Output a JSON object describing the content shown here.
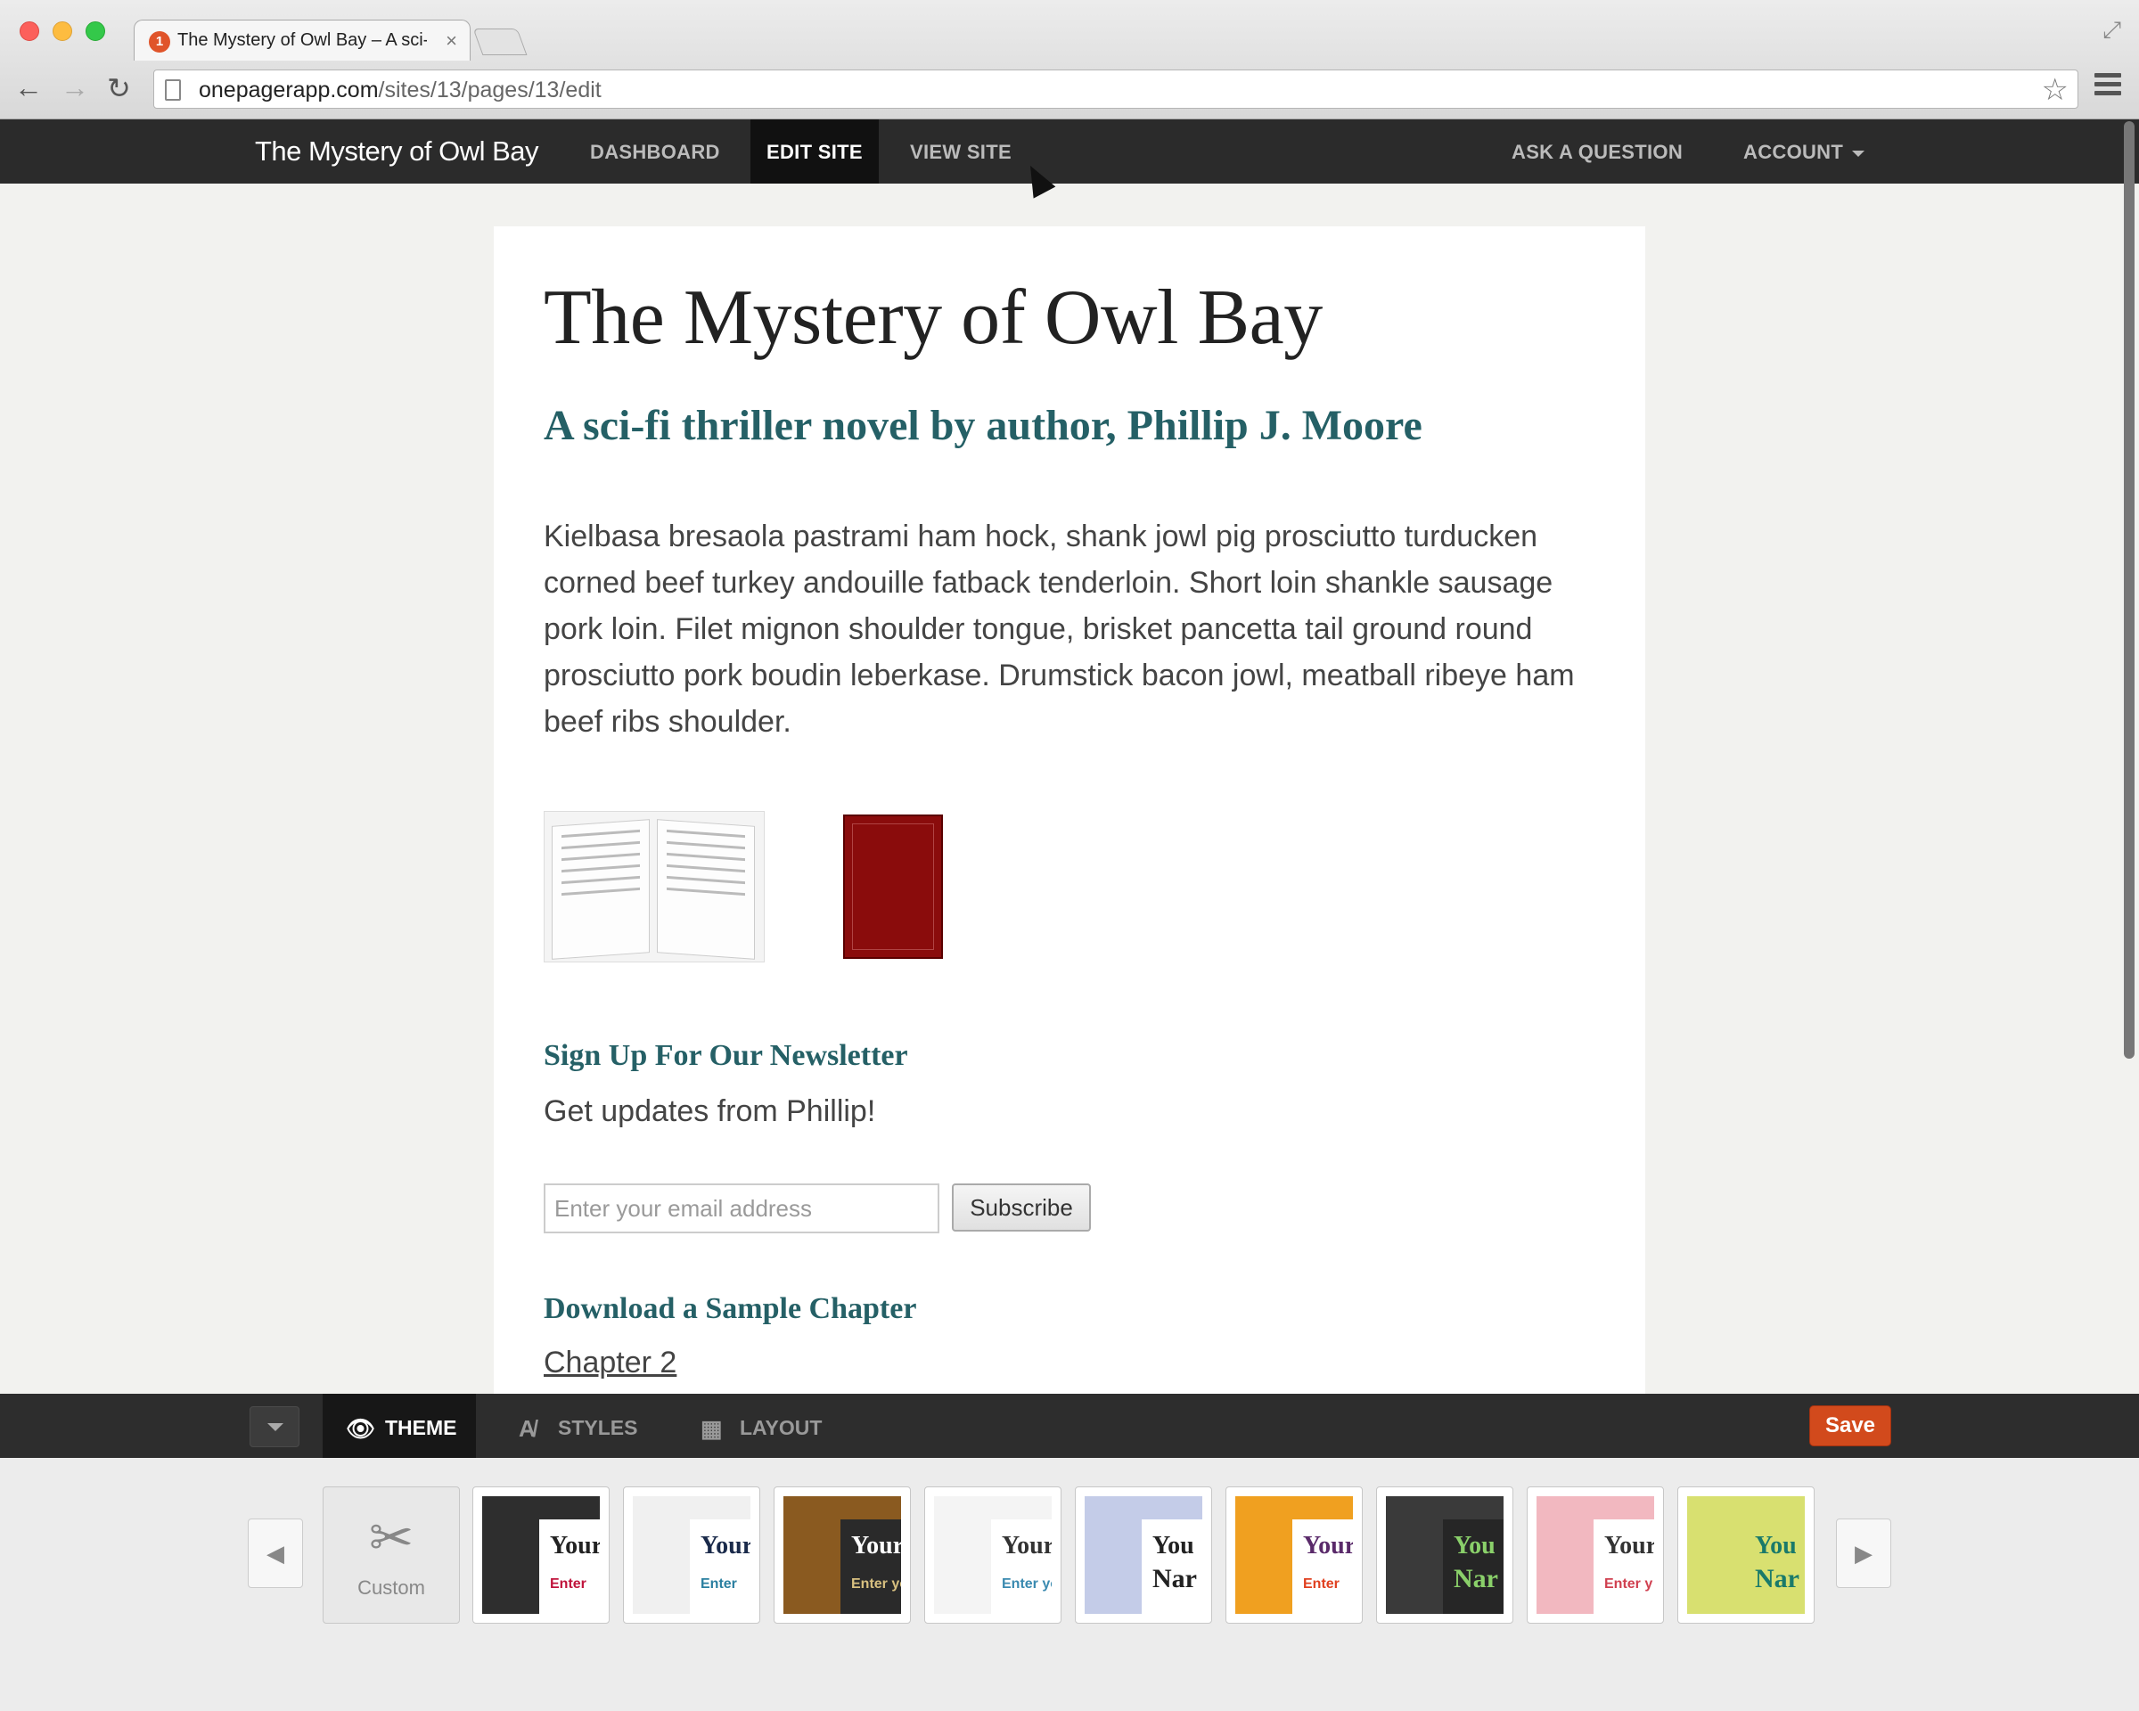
{
  "browser": {
    "tab_title": "The Mystery of Owl Bay – A sci-fi thriller",
    "tab_favicon": "1",
    "url_host": "onepagerapp.com",
    "url_path": "/sites/13/pages/13/edit"
  },
  "appbar": {
    "brand": "The Mystery of Owl Bay",
    "nav": [
      "DASHBOARD",
      "EDIT SITE",
      "VIEW SITE"
    ],
    "right": [
      "ASK A QUESTION",
      "ACCOUNT"
    ]
  },
  "page": {
    "title": "The Mystery of Owl Bay",
    "subtitle": "A sci-fi thriller novel by author, Phillip J. Moore",
    "body": "Kielbasa bresaola pastrami ham hock, shank jowl pig prosciutto turducken corned beef turkey andouille fatback tenderloin. Short loin shankle sausage pork loin. Filet mignon shoulder tongue, brisket pancetta tail ground round prosciutto pork boudin leberkase. Drumstick bacon jowl, meatball ribeye ham beef ribs shoulder.",
    "newsletter_heading": "Sign Up For Our Newsletter",
    "newsletter_text": "Get updates from Phillip!",
    "email_placeholder": "Enter your email address",
    "subscribe_label": "Subscribe",
    "sample_heading": "Download a Sample Chapter",
    "chapter_link": "Chapter 2"
  },
  "editor": {
    "tabs": [
      {
        "label": "THEME",
        "icon": "eye-icon",
        "active": true
      },
      {
        "label": "STYLES",
        "icon": "font-icon",
        "active": false
      },
      {
        "label": "LAYOUT",
        "icon": "layout-icon",
        "active": false
      }
    ],
    "save_label": "Save",
    "custom_label": "Custom",
    "themes": [
      {
        "line1": "Your",
        "line2": "Enter",
        "bg": "#2e2e2e",
        "panel": "#ffffff",
        "c1": "#222222",
        "c2": "#c0143c"
      },
      {
        "line1": "Your",
        "line2": "Enter",
        "bg": "#f0f0f0",
        "panel": "#ffffff",
        "c1": "#1a2a4a",
        "c2": "#2a7fa0"
      },
      {
        "line1": "Your",
        "line2": "Enter yo",
        "bg": "#8a5a20",
        "panel": "#2a2a2a",
        "c1": "#ffffff",
        "c2": "#d8c080"
      },
      {
        "line1": "Your",
        "line2": "Enter yo",
        "bg": "#f4f4f4",
        "panel": "#ffffff",
        "c1": "#333333",
        "c2": "#3a8ab0"
      },
      {
        "line1": "You",
        "line2": "Nar",
        "bg": "#c4cce8",
        "panel": "#ffffff",
        "c1": "#222222",
        "c2": "#222222"
      },
      {
        "line1": "Your",
        "line2": "Enter",
        "bg": "#f0a020",
        "panel": "#ffffff",
        "c1": "#5a2a6a",
        "c2": "#e04020"
      },
      {
        "line1": "You",
        "line2": "Nar",
        "bg": "#3a3a3a",
        "panel": "#262626",
        "c1": "#8ad06a",
        "c2": "#8ad06a"
      },
      {
        "line1": "Your",
        "line2": "Enter y",
        "bg": "#f2b8c0",
        "panel": "#ffffff",
        "c1": "#333333",
        "c2": "#d04050"
      },
      {
        "line1": "You",
        "line2": "Nar",
        "bg": "#d8e070",
        "panel": "#d8e070",
        "c1": "#1a7a6a",
        "c2": "#1a7a6a"
      }
    ]
  }
}
